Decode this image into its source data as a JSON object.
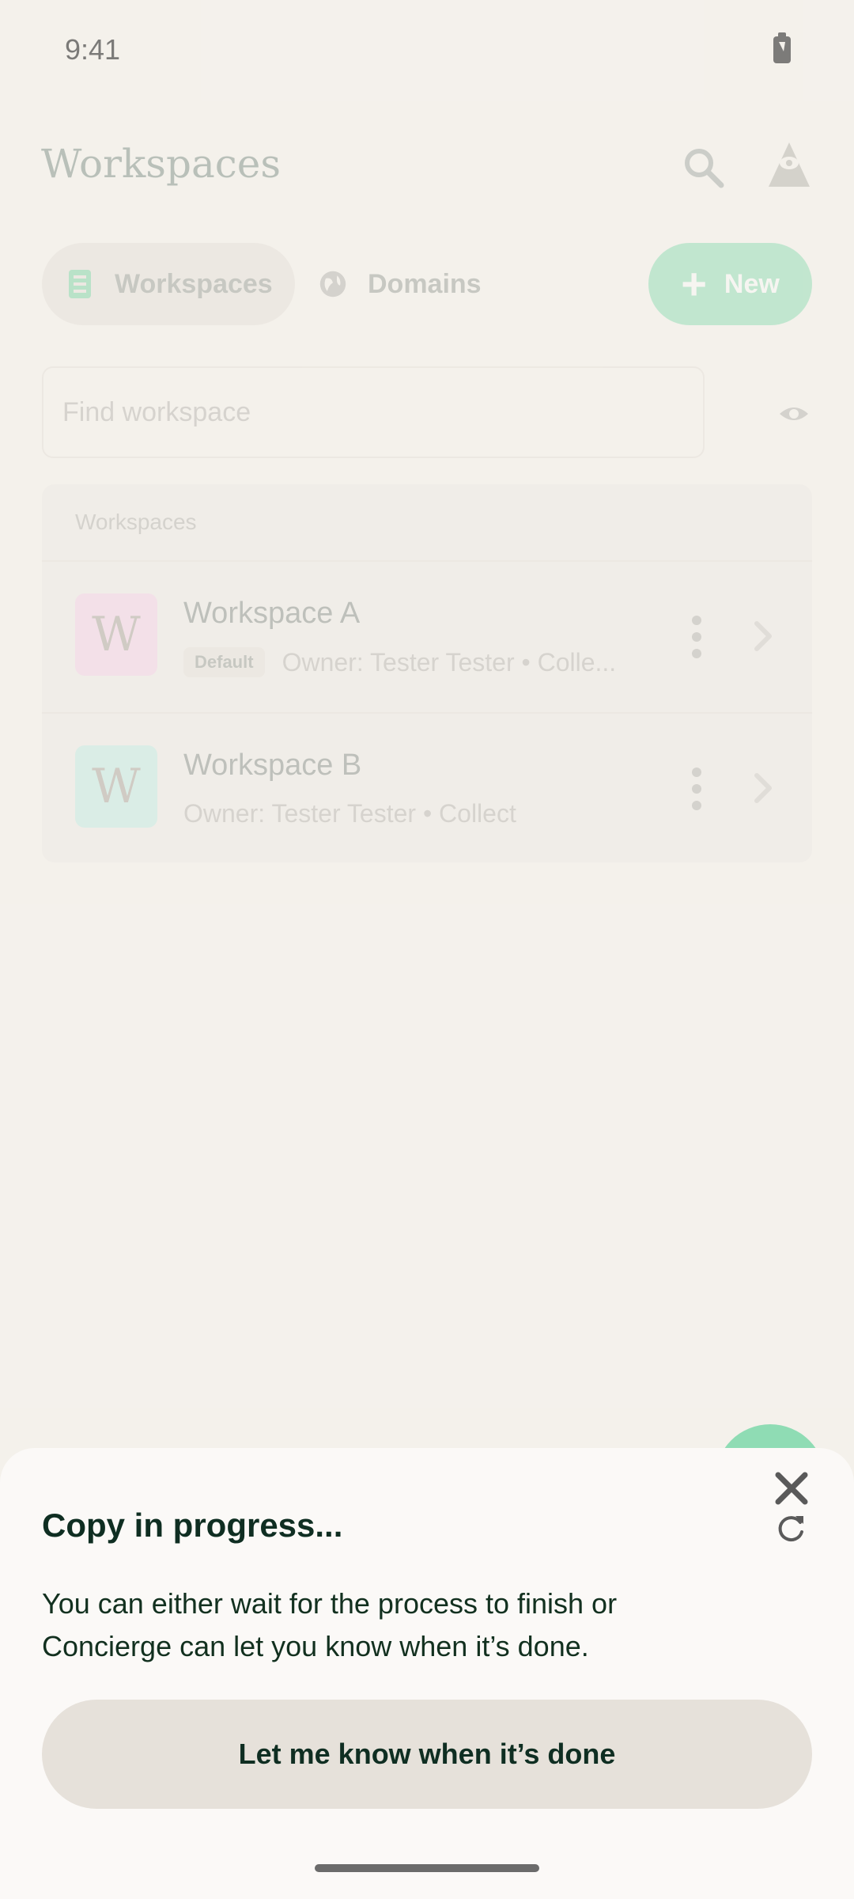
{
  "status_bar": {
    "time": "9:41"
  },
  "header": {
    "title": "Workspaces"
  },
  "tabs": [
    {
      "label": "Workspaces",
      "icon": "building-icon"
    },
    {
      "label": "Domains",
      "icon": "globe-icon"
    }
  ],
  "new_button": {
    "label": "New"
  },
  "search": {
    "placeholder": "Find workspace"
  },
  "list": {
    "header": "Workspaces",
    "rows": [
      {
        "avatar": "W",
        "avatar_color": "#f2b8e2",
        "title": "Workspace A",
        "badge": "Default",
        "subtitle": "Owner: Tester Tester • Colle..."
      },
      {
        "avatar": "W",
        "avatar_color": "#9fe6dc",
        "title": "Workspace B",
        "badge": "",
        "subtitle": "Owner: Tester Tester • Collect"
      }
    ]
  },
  "sheet": {
    "title": "Copy in progress...",
    "body": "You can either wait for the process to finish or Concierge can let you know when it’s done.",
    "button_label": "Let me know when it’s done"
  },
  "colors": {
    "accent": "#4ccf8f",
    "text_dark": "#0f2e22"
  }
}
